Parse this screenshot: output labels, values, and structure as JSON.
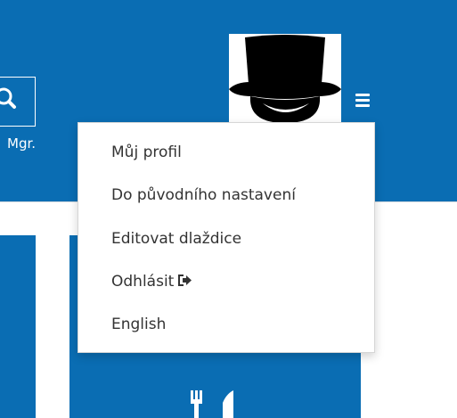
{
  "header": {
    "user_title": "Mgr.",
    "avatar_alt": "avatar"
  },
  "icons": {
    "search": "search-icon",
    "menu": "hamburger-menu-icon",
    "logout": "sign-out-icon",
    "tile": "cutlery-icon"
  },
  "dropdown": {
    "items": [
      {
        "label": "Můj profil"
      },
      {
        "label": "Do původního nastavení"
      },
      {
        "label": "Editovat dlaždice"
      },
      {
        "label": "Odhlásit"
      },
      {
        "label": "English"
      }
    ]
  },
  "colors": {
    "brand_blue": "#0a6db3",
    "menu_text": "#333333",
    "menu_bg": "#ffffff"
  }
}
